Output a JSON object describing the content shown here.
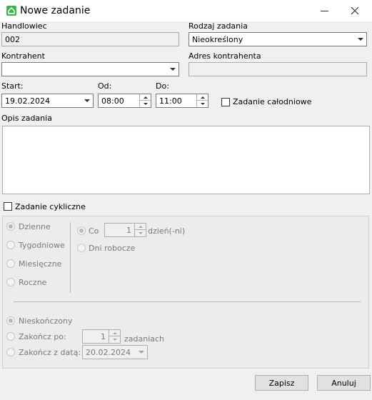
{
  "window": {
    "title": "Nowe zadanie"
  },
  "labels": {
    "handlowiec": "Handlowiec",
    "rodzaj": "Rodzaj zadania",
    "kontrahent": "Kontrahent",
    "adres": "Adres kontrahenta",
    "start": "Start:",
    "od": "Od:",
    "do": "Do:",
    "calodniowe": "Zadanie całodniowe",
    "opis": "Opis zadania",
    "cykliczne": "Zadanie cykliczne"
  },
  "fields": {
    "handlowiec": "002",
    "rodzaj": "Nieokreślony",
    "kontrahent": "",
    "adres": "",
    "start_date": "19.02.2024",
    "od_time": "08:00",
    "do_time": "11:00",
    "opis": ""
  },
  "cyclic": {
    "frequency": {
      "dzienne": "Dzienne",
      "tygodniowe": "Tygodniowe",
      "miesieczne": "Miesięczne",
      "roczne": "Roczne"
    },
    "co_label": "Co",
    "co_value": "1",
    "co_unit": "dzień(-ni)",
    "dni_robocze": "Dni robocze",
    "end": {
      "nieskonczony": "Nieskończony",
      "zakoncz_po": "Zakończ po:",
      "po_value": "1",
      "po_unit": "zadaniach",
      "zakoncz_data": "Zakończ z datą:",
      "end_date": "20.02.2024"
    }
  },
  "buttons": {
    "save": "Zapisz",
    "cancel": "Anuluj"
  },
  "colors": {
    "app_icon": "#3cb64a",
    "background": "#f0f0f0"
  }
}
